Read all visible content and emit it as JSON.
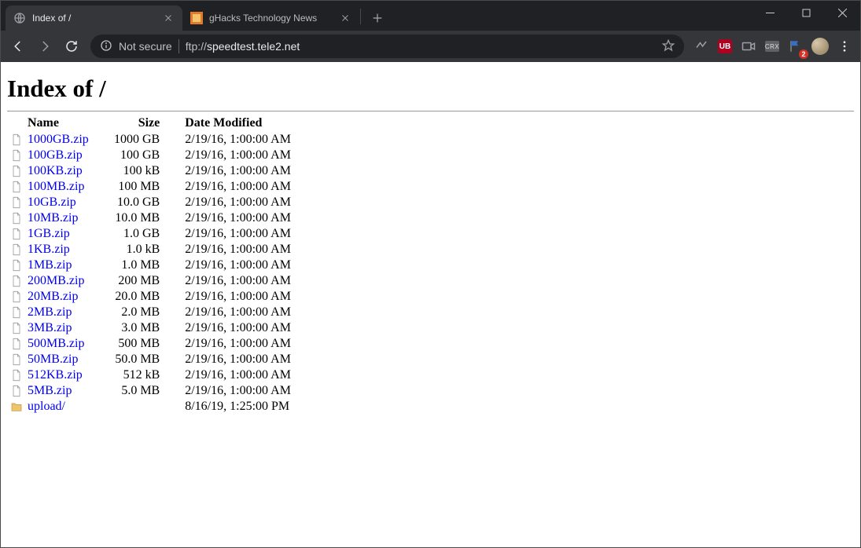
{
  "window": {
    "tabs": [
      {
        "title": "Index of /",
        "active": true,
        "favicon": "globe"
      },
      {
        "title": "gHacks Technology News",
        "active": false,
        "favicon": "ghacks"
      }
    ]
  },
  "toolbar": {
    "security_label": "Not secure",
    "url_scheme": "ftp://",
    "url_host": "speedtest.tele2.net",
    "badge_count": "2",
    "ext_ub": "UB",
    "ext_crx": "CRX"
  },
  "page": {
    "heading": "Index of /",
    "columns": {
      "name": "Name",
      "size": "Size",
      "date": "Date Modified"
    },
    "rows": [
      {
        "type": "file",
        "name": "1000GB.zip",
        "size": "1000 GB",
        "date": "2/19/16, 1:00:00 AM"
      },
      {
        "type": "file",
        "name": "100GB.zip",
        "size": "100 GB",
        "date": "2/19/16, 1:00:00 AM"
      },
      {
        "type": "file",
        "name": "100KB.zip",
        "size": "100 kB",
        "date": "2/19/16, 1:00:00 AM"
      },
      {
        "type": "file",
        "name": "100MB.zip",
        "size": "100 MB",
        "date": "2/19/16, 1:00:00 AM"
      },
      {
        "type": "file",
        "name": "10GB.zip",
        "size": "10.0 GB",
        "date": "2/19/16, 1:00:00 AM"
      },
      {
        "type": "file",
        "name": "10MB.zip",
        "size": "10.0 MB",
        "date": "2/19/16, 1:00:00 AM"
      },
      {
        "type": "file",
        "name": "1GB.zip",
        "size": "1.0 GB",
        "date": "2/19/16, 1:00:00 AM"
      },
      {
        "type": "file",
        "name": "1KB.zip",
        "size": "1.0 kB",
        "date": "2/19/16, 1:00:00 AM"
      },
      {
        "type": "file",
        "name": "1MB.zip",
        "size": "1.0 MB",
        "date": "2/19/16, 1:00:00 AM"
      },
      {
        "type": "file",
        "name": "200MB.zip",
        "size": "200 MB",
        "date": "2/19/16, 1:00:00 AM"
      },
      {
        "type": "file",
        "name": "20MB.zip",
        "size": "20.0 MB",
        "date": "2/19/16, 1:00:00 AM"
      },
      {
        "type": "file",
        "name": "2MB.zip",
        "size": "2.0 MB",
        "date": "2/19/16, 1:00:00 AM"
      },
      {
        "type": "file",
        "name": "3MB.zip",
        "size": "3.0 MB",
        "date": "2/19/16, 1:00:00 AM"
      },
      {
        "type": "file",
        "name": "500MB.zip",
        "size": "500 MB",
        "date": "2/19/16, 1:00:00 AM"
      },
      {
        "type": "file",
        "name": "50MB.zip",
        "size": "50.0 MB",
        "date": "2/19/16, 1:00:00 AM"
      },
      {
        "type": "file",
        "name": "512KB.zip",
        "size": "512 kB",
        "date": "2/19/16, 1:00:00 AM"
      },
      {
        "type": "file",
        "name": "5MB.zip",
        "size": "5.0 MB",
        "date": "2/19/16, 1:00:00 AM"
      },
      {
        "type": "folder",
        "name": "upload/",
        "size": "",
        "date": "8/16/19, 1:25:00 PM"
      }
    ]
  }
}
